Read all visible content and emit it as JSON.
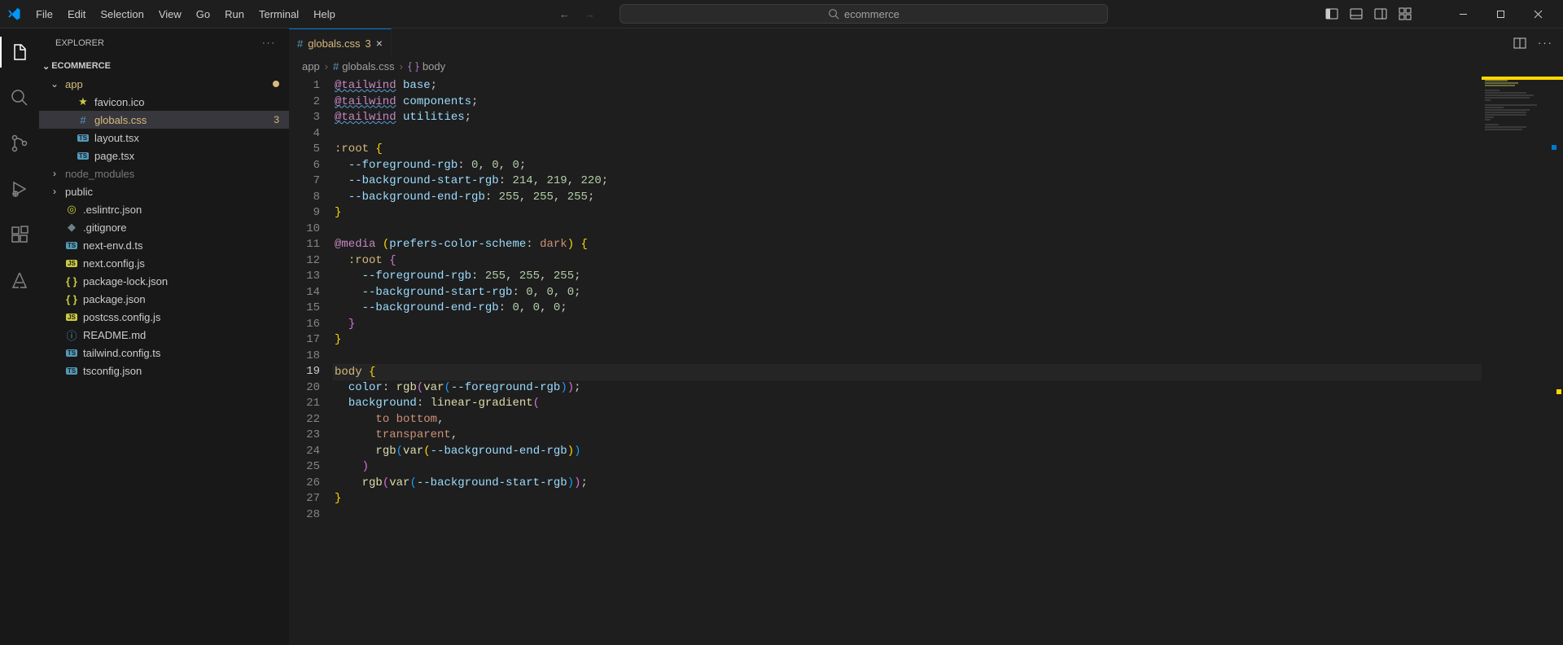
{
  "menubar": [
    "File",
    "Edit",
    "Selection",
    "View",
    "Go",
    "Run",
    "Terminal",
    "Help"
  ],
  "search": {
    "placeholder": "ecommerce"
  },
  "sidebar": {
    "title": "EXPLORER",
    "folder": "ECOMMERCE",
    "tree": [
      {
        "type": "folder",
        "name": "app",
        "depth": 0,
        "expanded": true,
        "modified": true,
        "dot": true
      },
      {
        "type": "file",
        "name": "favicon.ico",
        "depth": 1,
        "icon": "star"
      },
      {
        "type": "file",
        "name": "globals.css",
        "depth": 1,
        "icon": "hash",
        "selected": true,
        "modified": true,
        "badge": "3"
      },
      {
        "type": "file",
        "name": "layout.tsx",
        "depth": 1,
        "icon": "ts"
      },
      {
        "type": "file",
        "name": "page.tsx",
        "depth": 1,
        "icon": "ts"
      },
      {
        "type": "folder",
        "name": "node_modules",
        "depth": 0,
        "expanded": false,
        "dim": true
      },
      {
        "type": "folder",
        "name": "public",
        "depth": 0,
        "expanded": false
      },
      {
        "type": "file",
        "name": ".eslintrc.json",
        "depth": 0,
        "icon": "target"
      },
      {
        "type": "file",
        "name": ".gitignore",
        "depth": 0,
        "icon": "config"
      },
      {
        "type": "file",
        "name": "next-env.d.ts",
        "depth": 0,
        "icon": "ts"
      },
      {
        "type": "file",
        "name": "next.config.js",
        "depth": 0,
        "icon": "js"
      },
      {
        "type": "file",
        "name": "package-lock.json",
        "depth": 0,
        "icon": "json"
      },
      {
        "type": "file",
        "name": "package.json",
        "depth": 0,
        "icon": "json"
      },
      {
        "type": "file",
        "name": "postcss.config.js",
        "depth": 0,
        "icon": "js"
      },
      {
        "type": "file",
        "name": "README.md",
        "depth": 0,
        "icon": "info"
      },
      {
        "type": "file",
        "name": "tailwind.config.ts",
        "depth": 0,
        "icon": "ts"
      },
      {
        "type": "file",
        "name": "tsconfig.json",
        "depth": 0,
        "icon": "tsconfig"
      }
    ]
  },
  "tabs": [
    {
      "label": "globals.css",
      "icon": "hash",
      "modified_badge": "3",
      "active": true
    }
  ],
  "breadcrumb": [
    "app",
    "globals.css",
    "body"
  ],
  "editor": {
    "current_line": 19,
    "lines": [
      [
        {
          "t": "at",
          "v": "@tailwind"
        },
        {
          "t": "sp",
          "v": " "
        },
        {
          "t": "atword",
          "v": "base"
        },
        {
          "t": "punc",
          "v": ";"
        }
      ],
      [
        {
          "t": "at",
          "v": "@tailwind"
        },
        {
          "t": "sp",
          "v": " "
        },
        {
          "t": "atword",
          "v": "components"
        },
        {
          "t": "punc",
          "v": ";"
        }
      ],
      [
        {
          "t": "at",
          "v": "@tailwind"
        },
        {
          "t": "sp",
          "v": " "
        },
        {
          "t": "atword",
          "v": "utilities"
        },
        {
          "t": "punc",
          "v": ";"
        }
      ],
      [],
      [
        {
          "t": "sel",
          "v": ":root"
        },
        {
          "t": "sp",
          "v": " "
        },
        {
          "t": "brace",
          "v": "{"
        }
      ],
      [
        {
          "t": "sp",
          "v": "  "
        },
        {
          "t": "prop",
          "v": "--foreground-rgb"
        },
        {
          "t": "punc",
          "v": ": "
        },
        {
          "t": "num",
          "v": "0"
        },
        {
          "t": "punc",
          "v": ", "
        },
        {
          "t": "num",
          "v": "0"
        },
        {
          "t": "punc",
          "v": ", "
        },
        {
          "t": "num",
          "v": "0"
        },
        {
          "t": "punc",
          "v": ";"
        }
      ],
      [
        {
          "t": "sp",
          "v": "  "
        },
        {
          "t": "prop",
          "v": "--background-start-rgb"
        },
        {
          "t": "punc",
          "v": ": "
        },
        {
          "t": "num",
          "v": "214"
        },
        {
          "t": "punc",
          "v": ", "
        },
        {
          "t": "num",
          "v": "219"
        },
        {
          "t": "punc",
          "v": ", "
        },
        {
          "t": "num",
          "v": "220"
        },
        {
          "t": "punc",
          "v": ";"
        }
      ],
      [
        {
          "t": "sp",
          "v": "  "
        },
        {
          "t": "prop",
          "v": "--background-end-rgb"
        },
        {
          "t": "punc",
          "v": ": "
        },
        {
          "t": "num",
          "v": "255"
        },
        {
          "t": "punc",
          "v": ", "
        },
        {
          "t": "num",
          "v": "255"
        },
        {
          "t": "punc",
          "v": ", "
        },
        {
          "t": "num",
          "v": "255"
        },
        {
          "t": "punc",
          "v": ";"
        }
      ],
      [
        {
          "t": "brace",
          "v": "}"
        }
      ],
      [],
      [
        {
          "t": "kw",
          "v": "@media"
        },
        {
          "t": "sp",
          "v": " "
        },
        {
          "t": "brace",
          "v": "("
        },
        {
          "t": "prop",
          "v": "prefers-color-scheme"
        },
        {
          "t": "punc",
          "v": ": "
        },
        {
          "t": "const",
          "v": "dark"
        },
        {
          "t": "brace",
          "v": ")"
        },
        {
          "t": "sp",
          "v": " "
        },
        {
          "t": "brace",
          "v": "{"
        }
      ],
      [
        {
          "t": "sp",
          "v": "  "
        },
        {
          "t": "sel",
          "v": ":root"
        },
        {
          "t": "sp",
          "v": " "
        },
        {
          "t": "brace2",
          "v": "{"
        }
      ],
      [
        {
          "t": "sp",
          "v": "    "
        },
        {
          "t": "prop",
          "v": "--foreground-rgb"
        },
        {
          "t": "punc",
          "v": ": "
        },
        {
          "t": "num",
          "v": "255"
        },
        {
          "t": "punc",
          "v": ", "
        },
        {
          "t": "num",
          "v": "255"
        },
        {
          "t": "punc",
          "v": ", "
        },
        {
          "t": "num",
          "v": "255"
        },
        {
          "t": "punc",
          "v": ";"
        }
      ],
      [
        {
          "t": "sp",
          "v": "    "
        },
        {
          "t": "prop",
          "v": "--background-start-rgb"
        },
        {
          "t": "punc",
          "v": ": "
        },
        {
          "t": "num",
          "v": "0"
        },
        {
          "t": "punc",
          "v": ", "
        },
        {
          "t": "num",
          "v": "0"
        },
        {
          "t": "punc",
          "v": ", "
        },
        {
          "t": "num",
          "v": "0"
        },
        {
          "t": "punc",
          "v": ";"
        }
      ],
      [
        {
          "t": "sp",
          "v": "    "
        },
        {
          "t": "prop",
          "v": "--background-end-rgb"
        },
        {
          "t": "punc",
          "v": ": "
        },
        {
          "t": "num",
          "v": "0"
        },
        {
          "t": "punc",
          "v": ", "
        },
        {
          "t": "num",
          "v": "0"
        },
        {
          "t": "punc",
          "v": ", "
        },
        {
          "t": "num",
          "v": "0"
        },
        {
          "t": "punc",
          "v": ";"
        }
      ],
      [
        {
          "t": "sp",
          "v": "  "
        },
        {
          "t": "brace2",
          "v": "}"
        }
      ],
      [
        {
          "t": "brace",
          "v": "}"
        }
      ],
      [],
      [
        {
          "t": "sel",
          "v": "body"
        },
        {
          "t": "sp",
          "v": " "
        },
        {
          "t": "brace",
          "v": "{"
        }
      ],
      [
        {
          "t": "sp",
          "v": "  "
        },
        {
          "t": "prop",
          "v": "color"
        },
        {
          "t": "punc",
          "v": ": "
        },
        {
          "t": "func",
          "v": "rgb"
        },
        {
          "t": "brace2",
          "v": "("
        },
        {
          "t": "func",
          "v": "var"
        },
        {
          "t": "brace3",
          "v": "("
        },
        {
          "t": "prop",
          "v": "--foreground-rgb"
        },
        {
          "t": "brace3",
          "v": ")"
        },
        {
          "t": "brace2",
          "v": ")"
        },
        {
          "t": "punc",
          "v": ";"
        }
      ],
      [
        {
          "t": "sp",
          "v": "  "
        },
        {
          "t": "prop",
          "v": "background"
        },
        {
          "t": "punc",
          "v": ": "
        },
        {
          "t": "func",
          "v": "linear-gradient"
        },
        {
          "t": "brace2",
          "v": "("
        }
      ],
      [
        {
          "t": "sp",
          "v": "      "
        },
        {
          "t": "const",
          "v": "to "
        },
        {
          "t": "const",
          "v": "bottom"
        },
        {
          "t": "punc",
          "v": ","
        }
      ],
      [
        {
          "t": "sp",
          "v": "      "
        },
        {
          "t": "const",
          "v": "transparent"
        },
        {
          "t": "punc",
          "v": ","
        }
      ],
      [
        {
          "t": "sp",
          "v": "      "
        },
        {
          "t": "func",
          "v": "rgb"
        },
        {
          "t": "brace3",
          "v": "("
        },
        {
          "t": "func",
          "v": "var"
        },
        {
          "t": "brace",
          "v": "("
        },
        {
          "t": "prop",
          "v": "--background-end-rgb"
        },
        {
          "t": "brace",
          "v": ")"
        },
        {
          "t": "brace3",
          "v": ")"
        }
      ],
      [
        {
          "t": "sp",
          "v": "    "
        },
        {
          "t": "brace2",
          "v": ")"
        }
      ],
      [
        {
          "t": "sp",
          "v": "    "
        },
        {
          "t": "func",
          "v": "rgb"
        },
        {
          "t": "brace2",
          "v": "("
        },
        {
          "t": "func",
          "v": "var"
        },
        {
          "t": "brace3",
          "v": "("
        },
        {
          "t": "prop",
          "v": "--background-start-rgb"
        },
        {
          "t": "brace3",
          "v": ")"
        },
        {
          "t": "brace2",
          "v": ")"
        },
        {
          "t": "punc",
          "v": ";"
        }
      ],
      [
        {
          "t": "brace",
          "v": "}"
        }
      ],
      []
    ]
  }
}
